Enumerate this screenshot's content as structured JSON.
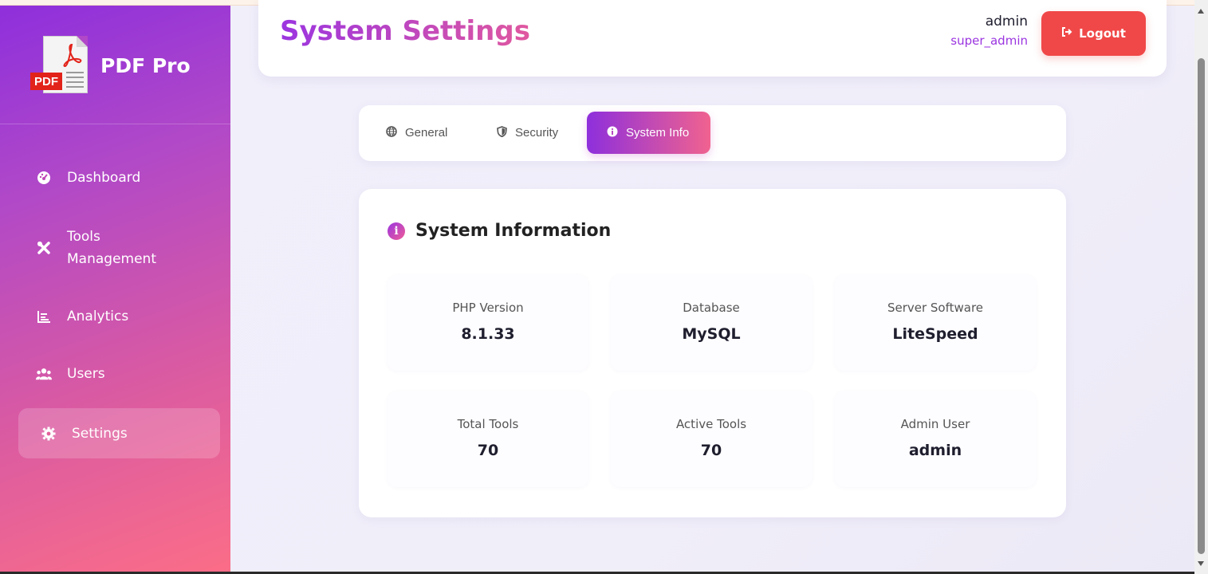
{
  "brand": {
    "name": "PDF Pro",
    "logo_tag": "PDF",
    "logo_icon": "pdf-file-icon"
  },
  "sidebar": {
    "items": [
      {
        "label": "Dashboard",
        "icon": "dashboard-icon"
      },
      {
        "label": "Tools\nManagement",
        "icon": "tools-icon"
      },
      {
        "label": "Analytics",
        "icon": "chart-icon"
      },
      {
        "label": "Users",
        "icon": "users-icon"
      },
      {
        "label": "Settings",
        "icon": "gear-icon",
        "active": true
      }
    ]
  },
  "header": {
    "title": "System Settings",
    "user_name": "admin",
    "user_role": "super_admin",
    "logout_label": "Logout"
  },
  "tabs": [
    {
      "label": "General",
      "icon": "globe-icon"
    },
    {
      "label": "Security",
      "icon": "shield-icon"
    },
    {
      "label": "System Info",
      "icon": "info-icon",
      "active": true
    }
  ],
  "system_info": {
    "heading": "System Information",
    "stats": [
      {
        "label": "PHP Version",
        "value": "8.1.33"
      },
      {
        "label": "Database",
        "value": "MySQL"
      },
      {
        "label": "Server Software",
        "value": "LiteSpeed"
      },
      {
        "label": "Total Tools",
        "value": "70"
      },
      {
        "label": "Active Tools",
        "value": "70"
      },
      {
        "label": "Admin User",
        "value": "admin"
      }
    ]
  },
  "colors": {
    "brand_gradient_start": "#8e2fdc",
    "brand_gradient_end": "#fb6d87",
    "logout": "#f04848",
    "accent_purple": "#9b35e0"
  }
}
